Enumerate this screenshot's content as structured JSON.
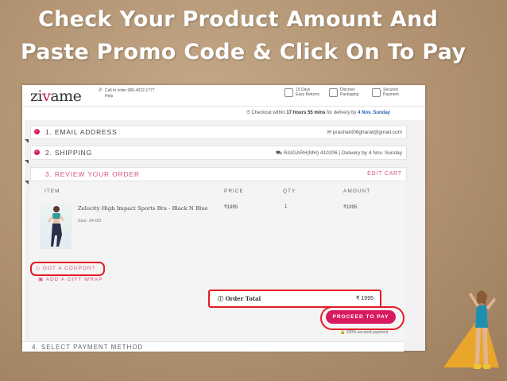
{
  "slide": {
    "headline_line1": "Check Your Product Amount And",
    "headline_line2": "Paste Promo Code & Click On To Pay"
  },
  "site": {
    "logo_prefix": "zi",
    "logo_x": "v",
    "logo_suffix": "ame",
    "call_line1": "Call to order 080-4922-1777",
    "call_line2": "Help",
    "features": [
      {
        "line1": "15 Days",
        "line2": "Easy Returns",
        "icon": "box-icon"
      },
      {
        "line1": "Discreet",
        "line2": "Packaging",
        "icon": "package-icon"
      },
      {
        "line1": "Secured",
        "line2": "Payment",
        "icon": "lock-icon"
      }
    ],
    "checkout_prefix": "Checkout within",
    "checkout_time": "17 hours 55 mins",
    "checkout_mid": "for delivery by",
    "checkout_date": "4 Nov. Sunday"
  },
  "steps": {
    "email": {
      "title": "1. EMAIL ADDRESS",
      "value": "prashant06gharat@gmail.com"
    },
    "shipping": {
      "title": "2. SHIPPING",
      "value": "RAIGARH(MH) 410206 | Delivery by 4 Nov. Sunday"
    },
    "review": {
      "title": "3. REVIEW YOUR ORDER",
      "edit": "EDIT CART"
    },
    "payment": {
      "title": "4. SELECT PAYMENT METHOD"
    }
  },
  "table": {
    "headers": [
      "ITEM",
      "PRICE",
      "QTY",
      "AMOUNT"
    ],
    "row": {
      "name": "Zelocity High Impact Sports Bra - Black N Blue",
      "size": "Size: 34 DD",
      "price": "₹1995",
      "qty": "1",
      "amount": "₹1995"
    }
  },
  "actions": {
    "coupon": "GOT A COUPON?",
    "gift": "ADD A GIFT WRAP",
    "order_total_label": "Order Total",
    "order_total_value": "₹ 1995",
    "pay_button": "PROCEED TO PAY",
    "secure_note": "100% secured payment"
  },
  "colors": {
    "accent": "#d81b60",
    "highlight": "#e51b24",
    "slide_bg": "#b39775"
  }
}
